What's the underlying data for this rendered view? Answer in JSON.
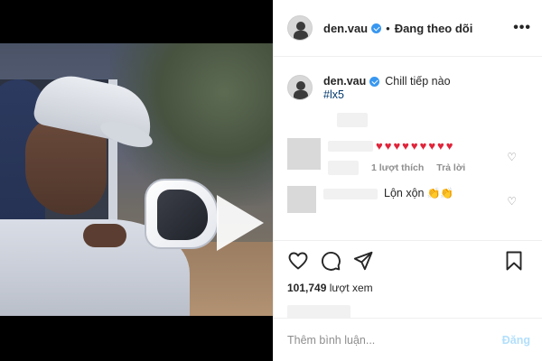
{
  "header": {
    "username": "den.vau",
    "separator": "•",
    "follow_status": "Đang theo dõi",
    "more_icon": "more-horizontal-icon"
  },
  "caption": {
    "username": "den.vau",
    "text": "Chill tiếp nào",
    "hashtag": "#lx5"
  },
  "comments": [
    {
      "hearts": "♥♥♥♥♥♥♥♥♥",
      "likes": "1 lượt thích",
      "reply": "Trả lời"
    },
    {
      "text": "Lộn xộn",
      "emoji": "👏👏"
    }
  ],
  "stats": {
    "views_count": "101,749",
    "views_label": "lượt xem"
  },
  "add_comment": {
    "placeholder": "Thêm bình luận...",
    "post_label": "Đăng"
  },
  "colors": {
    "verified": "#3897f0",
    "hashtag": "#00376b",
    "heart": "#e0243a",
    "post_button_disabled": "#b2dffc",
    "muted_text": "#8e8e8e"
  }
}
